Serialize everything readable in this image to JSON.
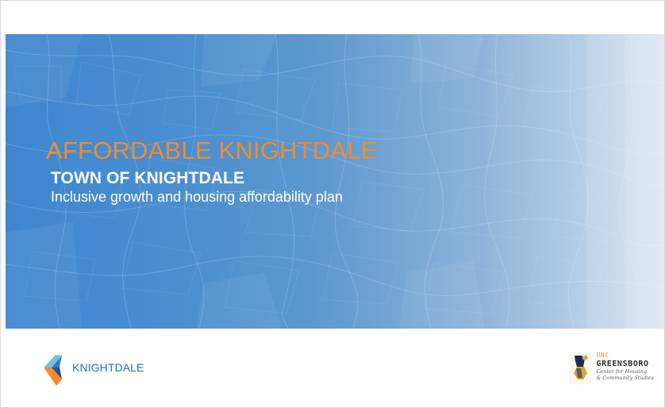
{
  "slide": {
    "title": "AFFORDABLE KNIGHTDALE",
    "subtitle": "TOWN OF KNIGHTDALE",
    "tagline": "Inclusive growth and housing affordability plan"
  },
  "left_logo": {
    "text": "KNIGHTDALE"
  },
  "right_logo": {
    "line1": "UNC",
    "line2": "GREENSBORO",
    "line3": "Center for Housing",
    "line4": "& Community Studies"
  },
  "colors": {
    "title": "#f28c2b",
    "hero_blue": "#3f86cf",
    "hero_light": "#d6e2ee",
    "white": "#ffffff",
    "knightdale_blue": "#1f6fb8",
    "uncg_gold": "#c8a048"
  },
  "icons": {
    "left_mark": "knightdale-logo-mark",
    "right_mark": "uncg-spartan-icon"
  }
}
